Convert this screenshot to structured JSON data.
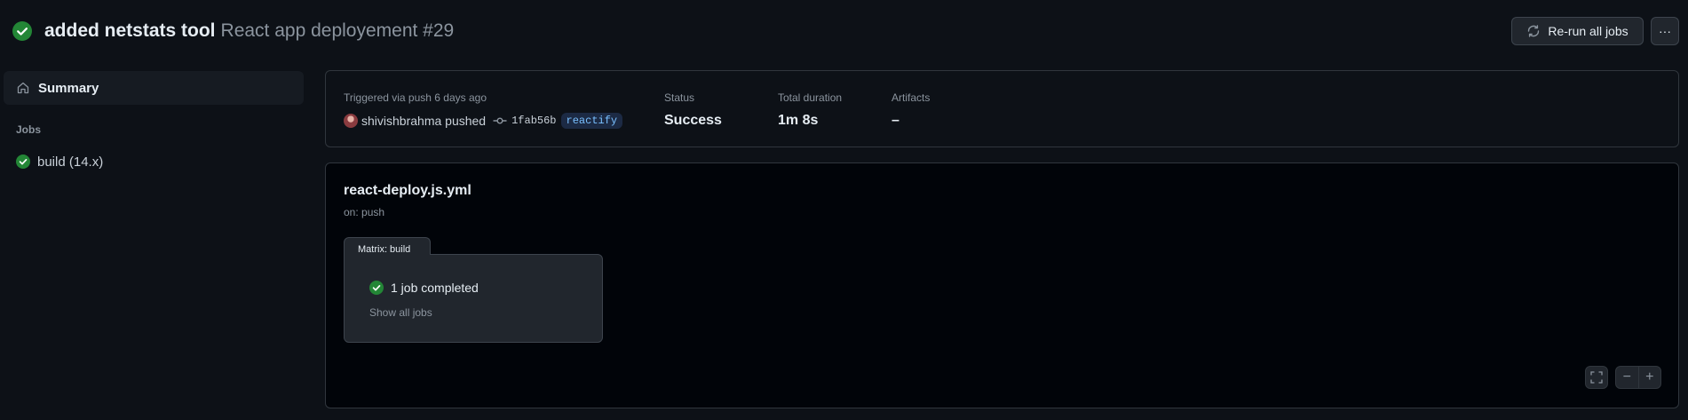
{
  "header": {
    "commit_message": "added netstats tool",
    "workflow_run": "React app deployement #29",
    "rerun_label": "Re-run all jobs",
    "more_label": "···"
  },
  "sidebar": {
    "summary_label": "Summary",
    "jobs_heading": "Jobs",
    "jobs": [
      {
        "label": "build (14.x)",
        "status": "success"
      }
    ]
  },
  "summary": {
    "trigger_label": "Triggered via push 6 days ago",
    "actor": "shivishbrahma pushed",
    "commit_sha": "1fab56b",
    "branch": "reactify",
    "status_label": "Status",
    "status_value": "Success",
    "duration_label": "Total duration",
    "duration_value": "1m 8s",
    "artifacts_label": "Artifacts",
    "artifacts_value": "–"
  },
  "workflow": {
    "file_name": "react-deploy.js.yml",
    "trigger": "on: push",
    "matrix_tab": "Matrix: build",
    "completed_text": "1 job completed",
    "show_all_link": "Show all jobs"
  },
  "zoom_controls": {
    "minus": "−",
    "plus": "+"
  },
  "colors": {
    "success": "#238636",
    "background": "#0d1117",
    "canvas": "#010409",
    "border": "#30363d",
    "branch_text": "#79c0ff",
    "branch_bg": "#1c2a44"
  },
  "icons": {
    "status": "check-circle-fill-icon",
    "rerun": "sync-icon",
    "summary": "home-icon",
    "commit": "git-commit-icon",
    "zoom_fit": "screen-full-icon"
  }
}
